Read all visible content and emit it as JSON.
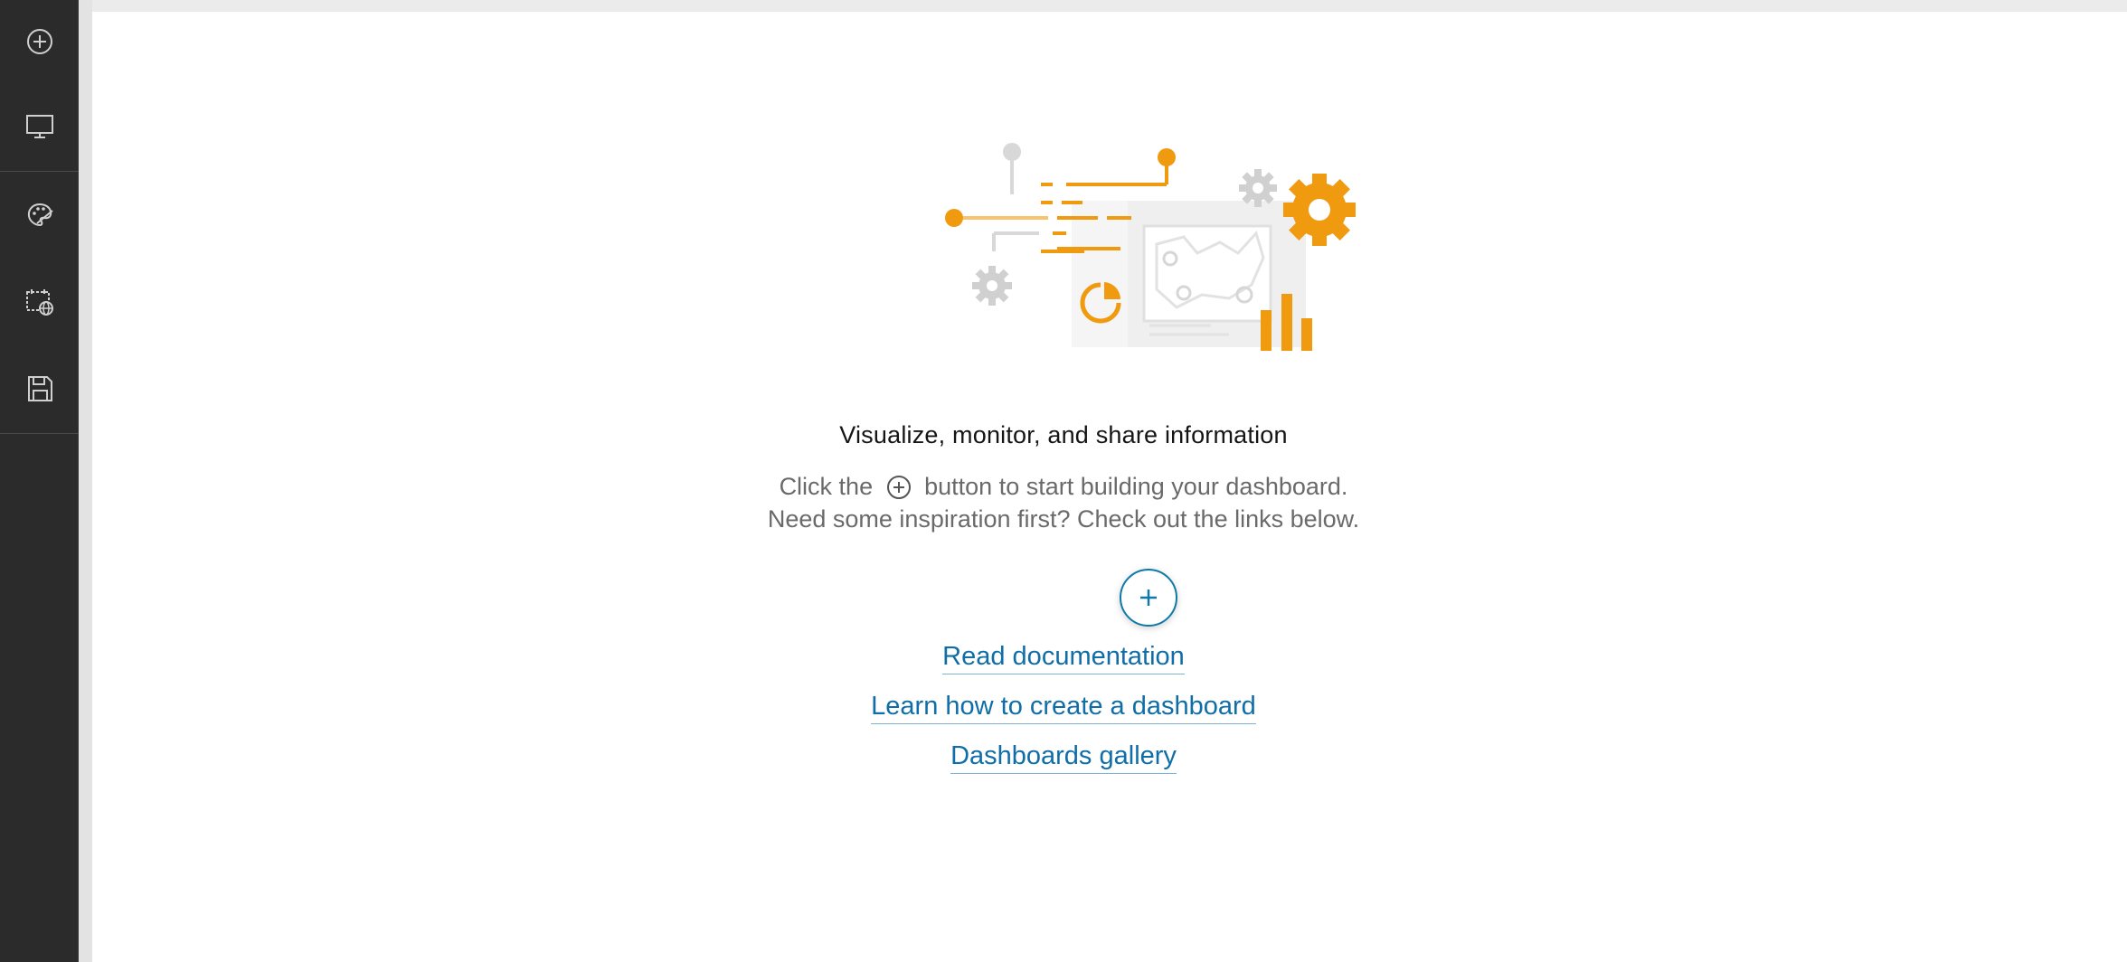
{
  "sidebar": {
    "items": [
      {
        "icon": "add-circle-icon"
      },
      {
        "icon": "monitor-icon"
      },
      {
        "icon": "palette-icon"
      },
      {
        "icon": "calendar-globe-icon"
      },
      {
        "icon": "save-icon"
      }
    ]
  },
  "main": {
    "title": "Visualize, monitor, and share information",
    "desc_line1_prefix": "Click the",
    "desc_line1_suffix": "button to start building your dashboard.",
    "desc_line2": "Need some inspiration first? Check out the links below.",
    "links": {
      "docs": "Read documentation",
      "learn": "Learn how to create a dashboard",
      "gallery": "Dashboards gallery"
    }
  },
  "colors": {
    "sidebar_bg": "#2b2b2b",
    "accent_orange": "#f09b0f",
    "link_blue": "#0f6ea8"
  }
}
